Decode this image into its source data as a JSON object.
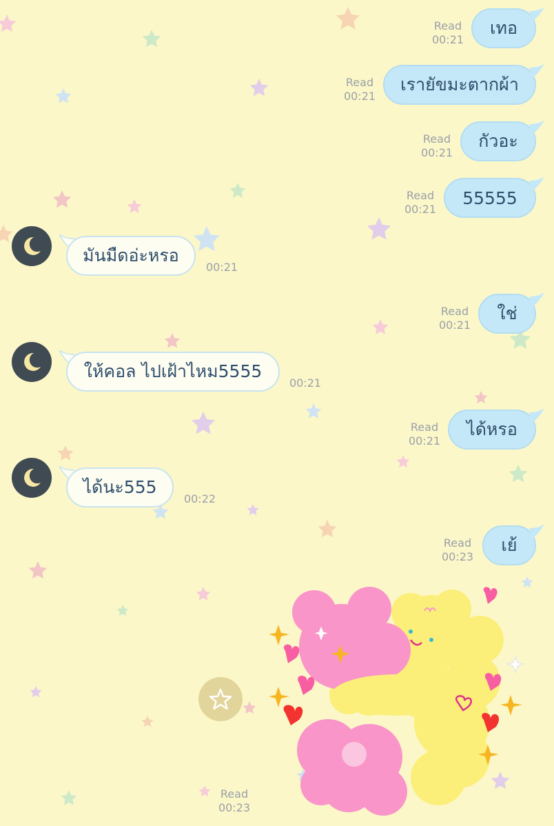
{
  "read_label": "Read",
  "messages": [
    {
      "side": "out",
      "text": "เทอ",
      "time": "00:21",
      "read": true
    },
    {
      "side": "out",
      "text": "เรายัขมะตากผ้า",
      "time": "00:21",
      "read": true
    },
    {
      "side": "out",
      "text": "กัวอะ",
      "time": "00:21",
      "read": true
    },
    {
      "side": "out",
      "text": "55555",
      "time": "00:21",
      "read": true
    },
    {
      "side": "in",
      "text": "มันมืดอ่ะหรอ",
      "time": "00:21",
      "avatar_icon": "moon-icon"
    },
    {
      "side": "out",
      "text": "ใช่",
      "time": "00:21",
      "read": true
    },
    {
      "side": "in",
      "text": "ให้คอล ไปเฝ้าไหม5555",
      "time": "00:21",
      "avatar_icon": "moon-icon"
    },
    {
      "side": "out",
      "text": "ได้หรอ",
      "time": "00:21",
      "read": true
    },
    {
      "side": "in",
      "text": "ได้นะ555",
      "time": "00:22",
      "avatar_icon": "moon-icon"
    },
    {
      "side": "out",
      "text": "เย้",
      "time": "00:23",
      "read": true
    }
  ],
  "sticker_message": {
    "time": "00:23",
    "read": true,
    "sticker": "pink-bear-hugging-yellow-puppy-sticker"
  },
  "colors": {
    "background": "#fbf7c9",
    "outgoing_bubble": "#c5e8f8",
    "incoming_bubble": "#fdfdf2",
    "message_text": "#2e4d6b",
    "meta_text": "#9aa0a8",
    "avatar_bg": "#3f4a52",
    "favorite_button_bg": "#e2d59b"
  },
  "icons": {
    "avatar": "moon-icon",
    "favorite": "star-outline-icon"
  }
}
